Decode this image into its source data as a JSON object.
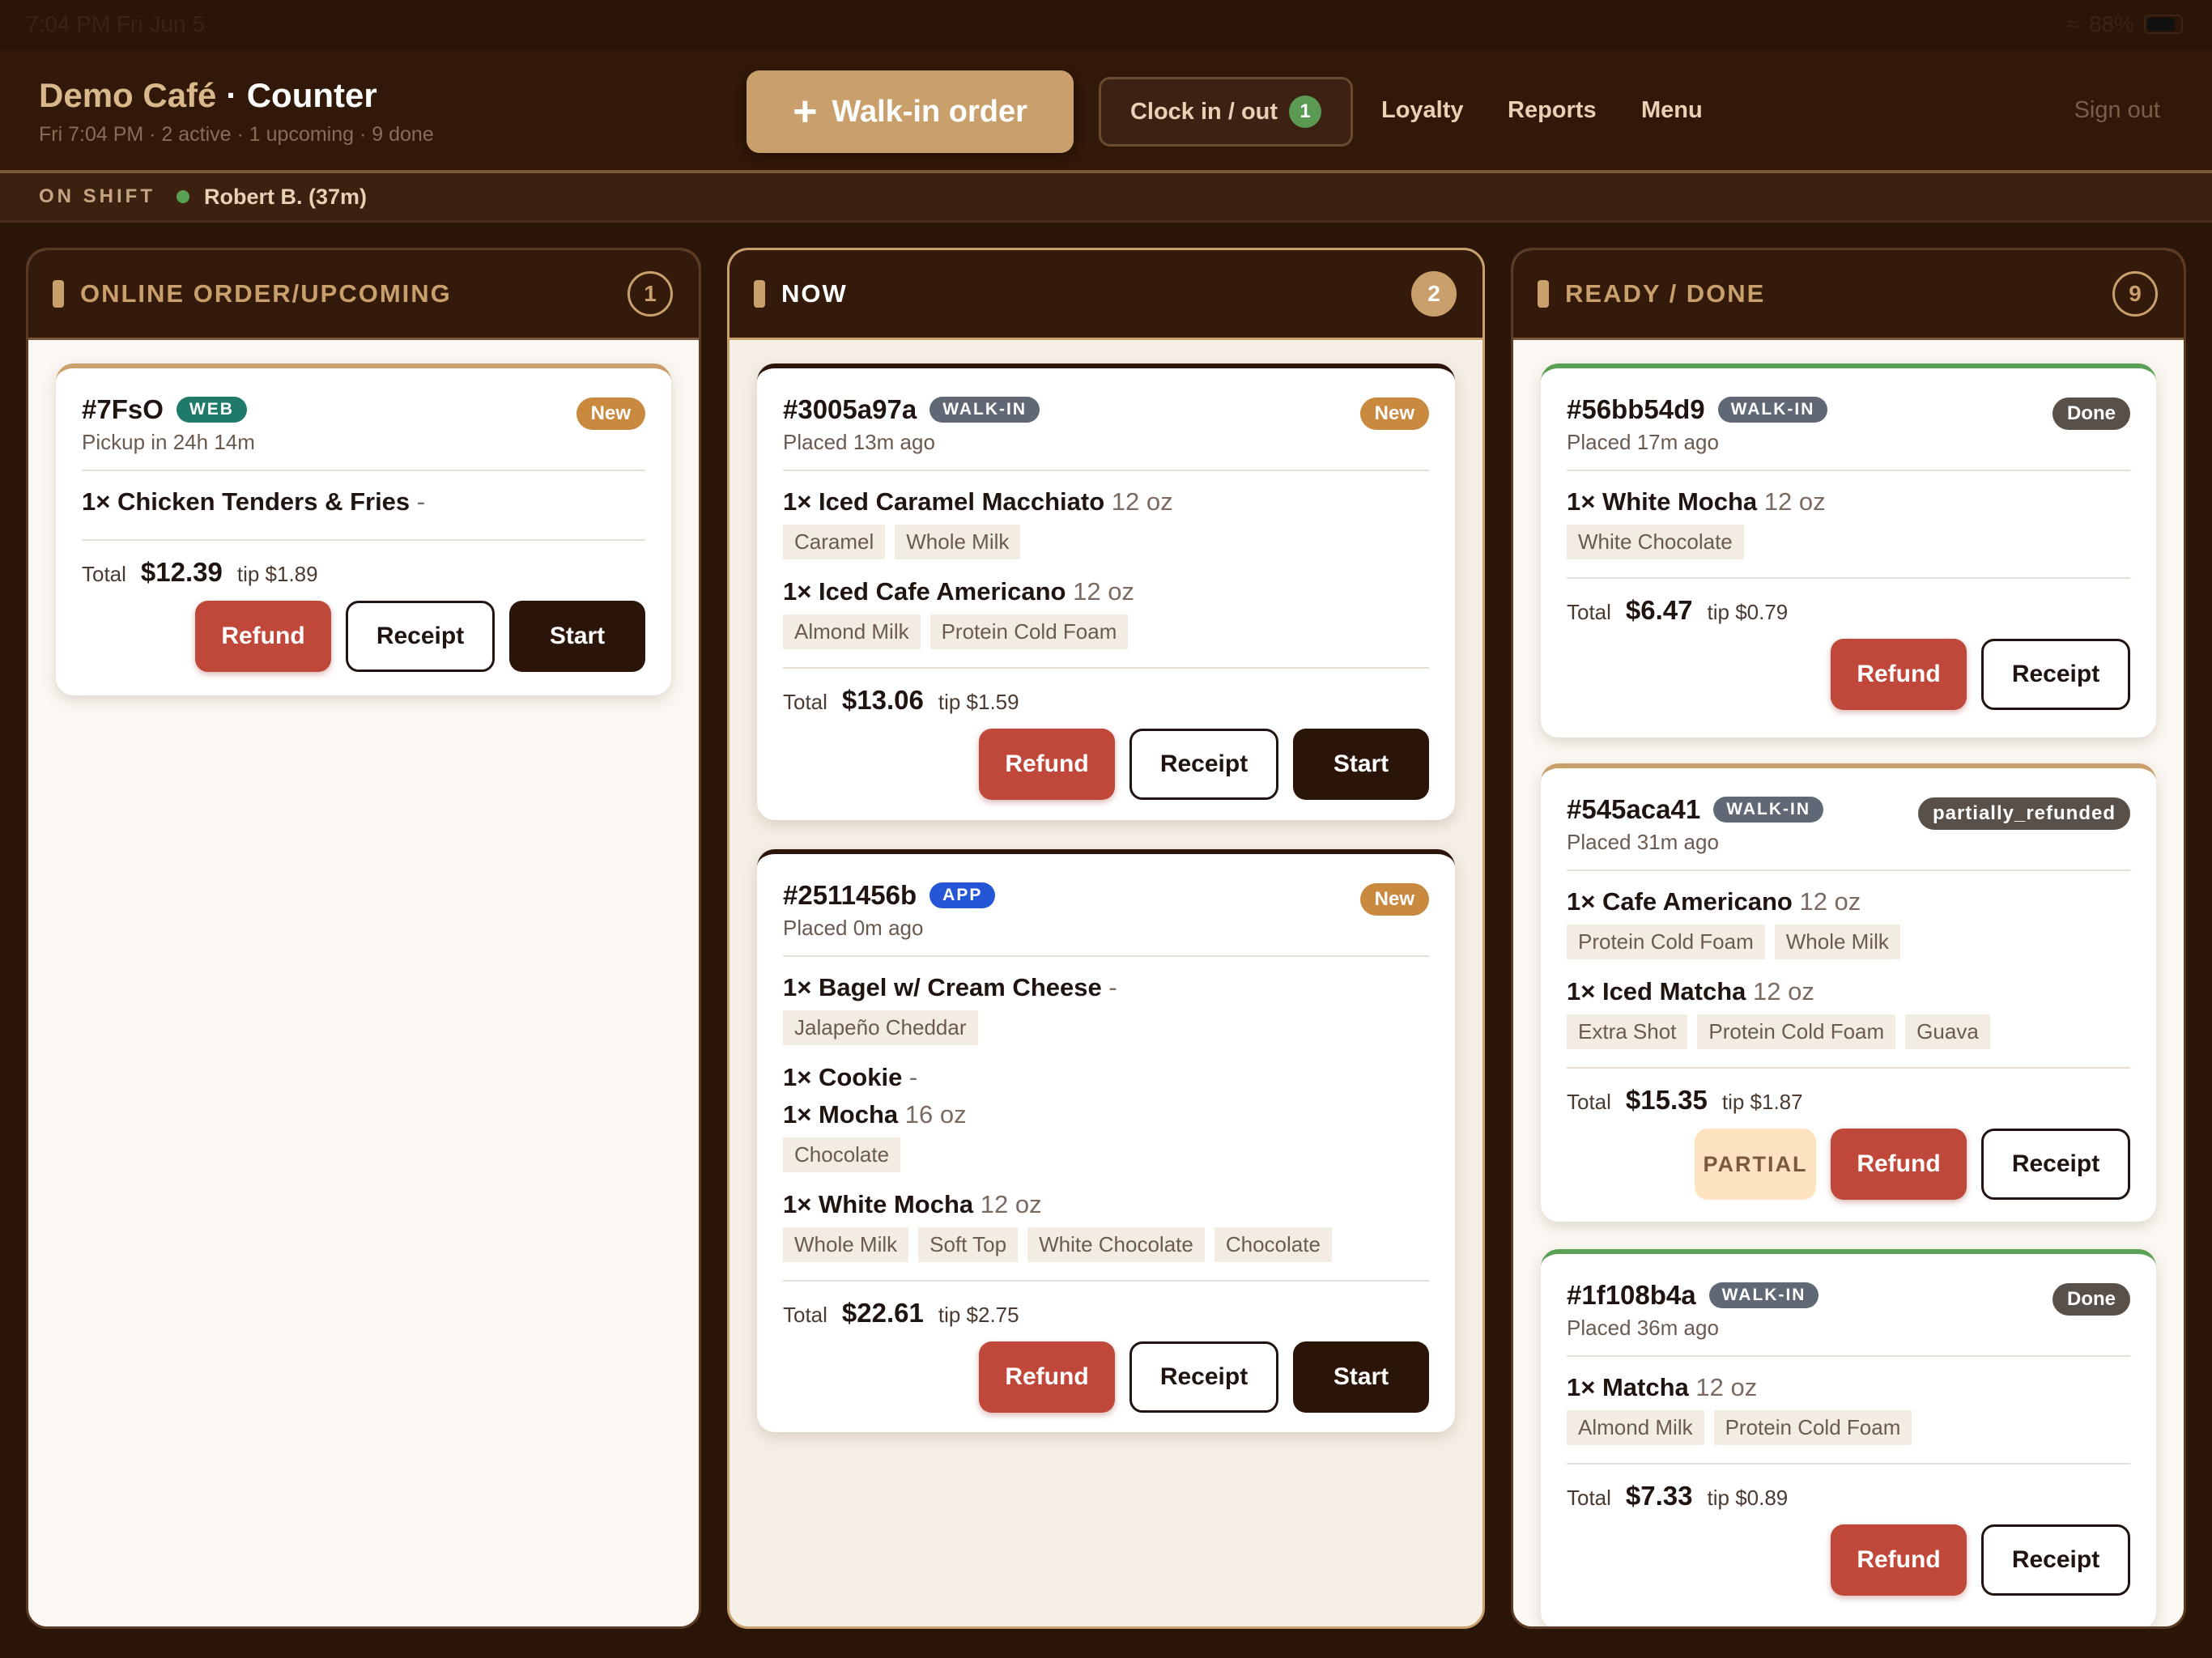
{
  "status": {
    "time": "7:04 PM   Fri Jun 5",
    "battery": "88%"
  },
  "header": {
    "brand_name": "Demo Café",
    "brand_suffix": " · Counter",
    "subtitle": "Fri 7:04 PM · 2 active · 1 upcoming · 9 done",
    "walkin_label": "Walk-in order",
    "clock_label": "Clock in / out",
    "clock_badge": "1",
    "nav": [
      "Loyalty",
      "Reports",
      "Menu"
    ],
    "signout": "Sign out"
  },
  "shift": {
    "label": "ON SHIFT",
    "who": "Robert B. (37m)"
  },
  "columns": [
    {
      "title": "ONLINE ORDER/UPCOMING",
      "count": "1"
    },
    {
      "title": "NOW",
      "count": "2"
    },
    {
      "title": "READY / DONE",
      "count": "9"
    }
  ],
  "orders": {
    "o1": {
      "id": "#7FsO",
      "tag": "WEB",
      "state": "New",
      "placed": "Pickup in 24h 14m",
      "items": [
        {
          "name": "1× Chicken Tenders & Fries",
          "size": " -"
        }
      ],
      "total_label": "Total",
      "total": "$12.39",
      "tip": "tip $1.89"
    },
    "o2": {
      "id": "#3005a97a",
      "tag": "WALK-IN",
      "state": "New",
      "placed": "Placed 13m ago",
      "items": [
        {
          "name": "1× Iced Caramel Macchiato",
          "size": " 12 oz",
          "mods": [
            "Caramel",
            "Whole Milk"
          ]
        },
        {
          "name": "1× Iced Cafe Americano",
          "size": " 12 oz",
          "mods": [
            "Almond Milk",
            "Protein Cold Foam"
          ]
        }
      ],
      "total_label": "Total",
      "total": "$13.06",
      "tip": "tip $1.59"
    },
    "o3": {
      "id": "#2511456b",
      "tag": "APP",
      "state": "New",
      "placed": "Placed 0m ago",
      "items": [
        {
          "name": "1× Bagel w/ Cream Cheese",
          "size": " -",
          "mods": [
            "Jalapeño Cheddar"
          ]
        },
        {
          "name": "1× Cookie",
          "size": " -"
        },
        {
          "name": "1× Mocha",
          "size": " 16 oz",
          "mods": [
            "Chocolate"
          ]
        },
        {
          "name": "1× White Mocha",
          "size": " 12 oz",
          "mods": [
            "Whole Milk",
            "Soft Top",
            "White Chocolate",
            "Chocolate"
          ]
        }
      ],
      "total_label": "Total",
      "total": "$22.61",
      "tip": "tip $2.75"
    },
    "o4": {
      "id": "#56bb54d9",
      "tag": "WALK-IN",
      "state": "Done",
      "placed": "Placed 17m ago",
      "items": [
        {
          "name": "1× White Mocha",
          "size": " 12 oz",
          "mods": [
            "White Chocolate"
          ]
        }
      ],
      "total_label": "Total",
      "total": "$6.47",
      "tip": "tip $0.79"
    },
    "o5": {
      "id": "#545aca41",
      "tag": "WALK-IN",
      "state": "partially_refunded",
      "placed": "Placed 31m ago",
      "items": [
        {
          "name": "1× Cafe Americano",
          "size": " 12 oz",
          "mods": [
            "Protein Cold Foam",
            "Whole Milk"
          ]
        },
        {
          "name": "1× Iced Matcha",
          "size": " 12 oz",
          "mods": [
            "Extra Shot",
            "Protein Cold Foam",
            "Guava"
          ]
        }
      ],
      "total_label": "Total",
      "total": "$15.35",
      "tip": "tip $1.87",
      "partial_label": "PARTIAL"
    },
    "o6": {
      "id": "#1f108b4a",
      "tag": "WALK-IN",
      "state": "Done",
      "placed": "Placed 36m ago",
      "items": [
        {
          "name": "1× Matcha",
          "size": " 12 oz",
          "mods": [
            "Almond Milk",
            "Protein Cold Foam"
          ]
        }
      ],
      "total_label": "Total",
      "total": "$7.33",
      "tip": "tip $0.89"
    }
  },
  "buttons": {
    "refund": "Refund",
    "receipt": "Receipt",
    "start": "Start"
  },
  "icons": {
    "plus": "plus-icon",
    "wifi": "wifi-icon",
    "battery": "battery-icon"
  },
  "colors": {
    "accent": "#c9a06c",
    "refund": "#c0483a",
    "dark": "#2b1408",
    "online": "#5aa055"
  }
}
